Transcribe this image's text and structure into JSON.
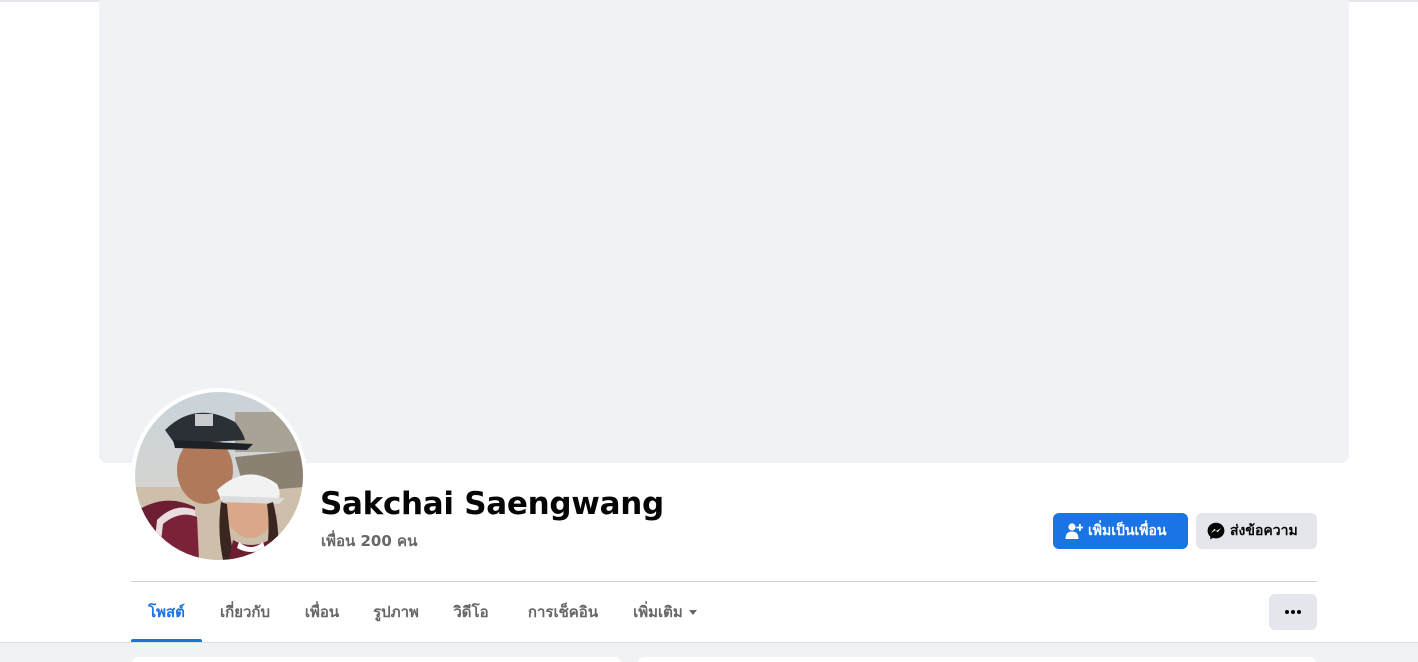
{
  "profile": {
    "name": "Sakchai Saengwang",
    "friends_text": "เพื่อน 200 คน"
  },
  "actions": {
    "add_friend_label": "เพิ่มเป็นเพื่อน",
    "message_label": "ส่งข้อความ"
  },
  "tabs": [
    {
      "label": "โพสต์",
      "active": true
    },
    {
      "label": "เกี่ยวกับ",
      "active": false
    },
    {
      "label": "เพื่อน",
      "active": false
    },
    {
      "label": "รูปภาพ",
      "active": false
    },
    {
      "label": "วิดีโอ",
      "active": false
    },
    {
      "label": "การเช็คอิน",
      "active": false
    },
    {
      "label": "เพิ่มเติม",
      "active": false
    }
  ],
  "icons": {
    "add_friend": "add-person-icon",
    "message": "messenger-icon",
    "more": "ellipsis-icon",
    "dropdown": "caret-down-icon"
  },
  "colors": {
    "accent": "#1b74e4",
    "cover": "#f0f2f5",
    "secondary_text": "#65676b",
    "secondary_button": "#e4e6eb"
  }
}
